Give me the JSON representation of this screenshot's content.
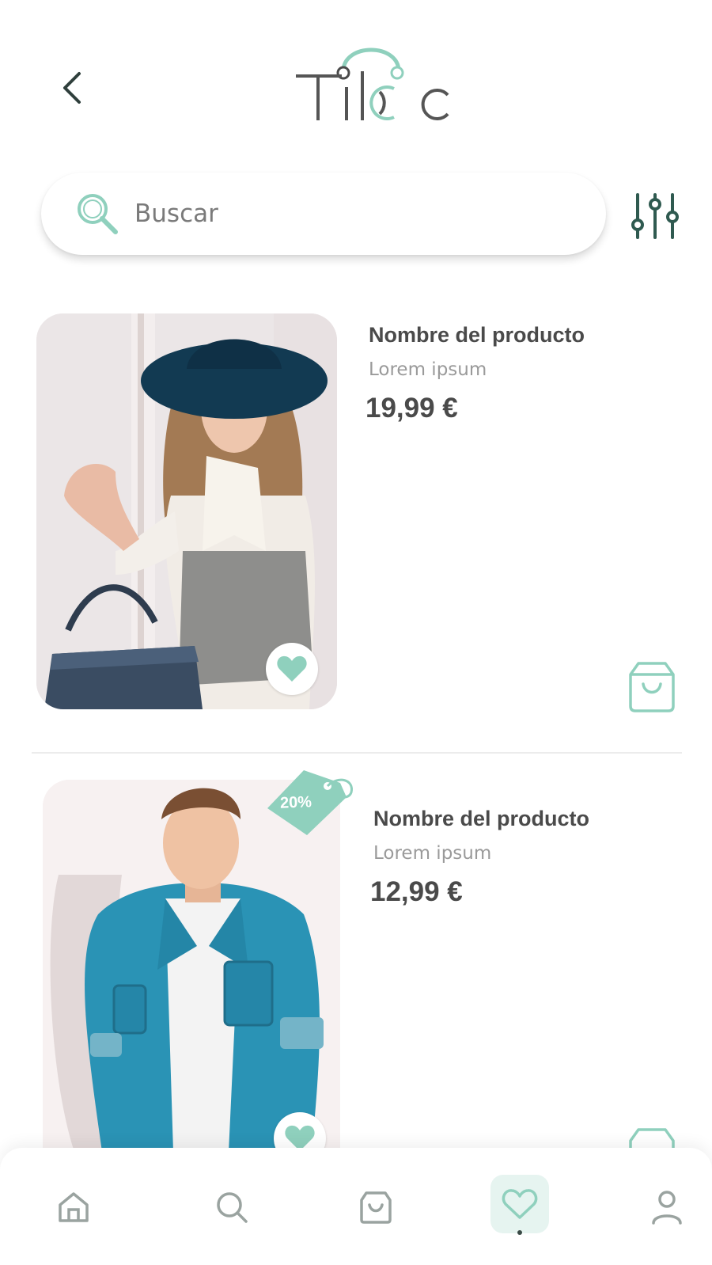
{
  "app": {
    "brand": "Tiloc"
  },
  "header": {
    "back_icon": "chevron-left-icon"
  },
  "search": {
    "placeholder": "Buscar",
    "icon": "search-icon"
  },
  "filter": {
    "icon": "sliders-icon"
  },
  "products": [
    {
      "name": "Nombre del producto",
      "subtitle": "Lorem ipsum",
      "price": "19,99 €",
      "favorite": true
    },
    {
      "name": "Nombre del producto",
      "subtitle": "Lorem ipsum",
      "price": "12,99 €",
      "discount": "20%",
      "favorite": true
    }
  ],
  "bottom_nav": {
    "items": [
      "home-icon",
      "search-icon",
      "bag-icon",
      "heart-icon",
      "user-icon"
    ],
    "active": "heart-icon"
  },
  "colors": {
    "accent": "#8fd0bd",
    "accent_dark": "#2f5a50",
    "text": "#4a4a4a",
    "muted": "#9a9a9a",
    "nav_active_bg": "#e6f4f0"
  }
}
